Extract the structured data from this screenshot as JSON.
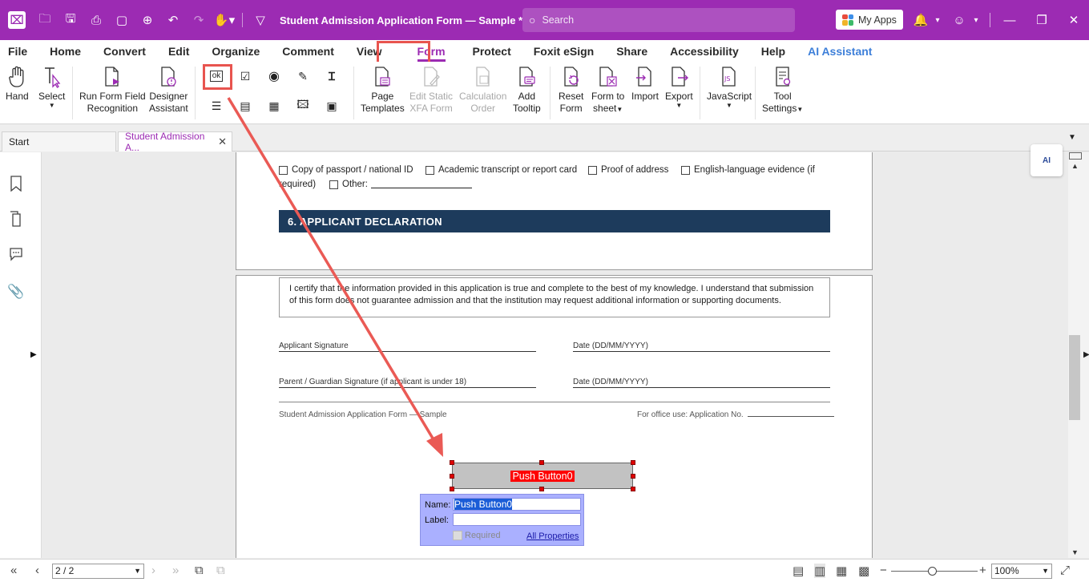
{
  "titlebar": {
    "doc_title": "Student Admission Application Form — Sample *",
    "search_placeholder": "Search",
    "my_apps": "My Apps"
  },
  "menu": {
    "items": [
      "File",
      "Home",
      "Convert",
      "Edit",
      "Organize",
      "Comment",
      "View",
      "Form",
      "Protect",
      "Foxit eSign",
      "Share",
      "Accessibility",
      "Help",
      "AI Assistant"
    ],
    "active": "Form"
  },
  "ribbon": {
    "hand": "Hand",
    "select": "Select",
    "run_form_field_1": "Run Form Field",
    "run_form_field_2": "Recognition",
    "designer_1": "Designer",
    "designer_2": "Assistant",
    "page_templates_1": "Page",
    "page_templates_2": "Templates",
    "edit_static_1": "Edit Static",
    "edit_static_2": "XFA Form",
    "calc_order_1": "Calculation",
    "calc_order_2": "Order",
    "add_tooltip_1": "Add",
    "add_tooltip_2": "Tooltip",
    "reset_form_1": "Reset",
    "reset_form_2": "Form",
    "form_to_sheet_1": "Form to",
    "form_to_sheet_2": "sheet",
    "import": "Import",
    "export": "Export",
    "javascript": "JavaScript",
    "tool_settings_1": "Tool",
    "tool_settings_2": "Settings",
    "ok_icon_text": "ok",
    "js_icon_text": "JS"
  },
  "tabs": {
    "start": "Start",
    "doc": "Student Admission A..."
  },
  "page1": {
    "chk_passport": "Copy of passport / national ID",
    "chk_transcript": "Academic transcript or report card",
    "chk_address": "Proof of address",
    "chk_english": "English-language evidence (if",
    "required_text": "required)",
    "chk_other": "Other:",
    "section_title": "6. APPLICANT DECLARATION"
  },
  "page2": {
    "declaration": "I certify that the information provided in this application is true and complete to the best of my knowledge. I understand that submission of this form does not guarantee admission and that the institution may request additional information or supporting documents.",
    "applicant_signature": "Applicant Signature",
    "date1": "Date (DD/MM/YYYY)",
    "parent_signature": "Parent / Guardian Signature (if applicant is under 18)",
    "date2": "Date (DD/MM/YYYY)",
    "footer_left": "Student Admission Application Form — Sample",
    "footer_right": "For office use: Application No."
  },
  "widget": {
    "button_label": "Push Button0",
    "name_label": "Name:",
    "name_value": "Push Button0",
    "label_label": "Label:",
    "label_value": "",
    "required": "Required",
    "all_properties": "All Properties"
  },
  "ai_bubble": "AI",
  "status": {
    "page": "2 / 2",
    "zoom": "100%"
  },
  "colors": {
    "brand": "#9c2bb3",
    "highlight": "#e8544f",
    "section_bg": "#1d3b5c"
  }
}
